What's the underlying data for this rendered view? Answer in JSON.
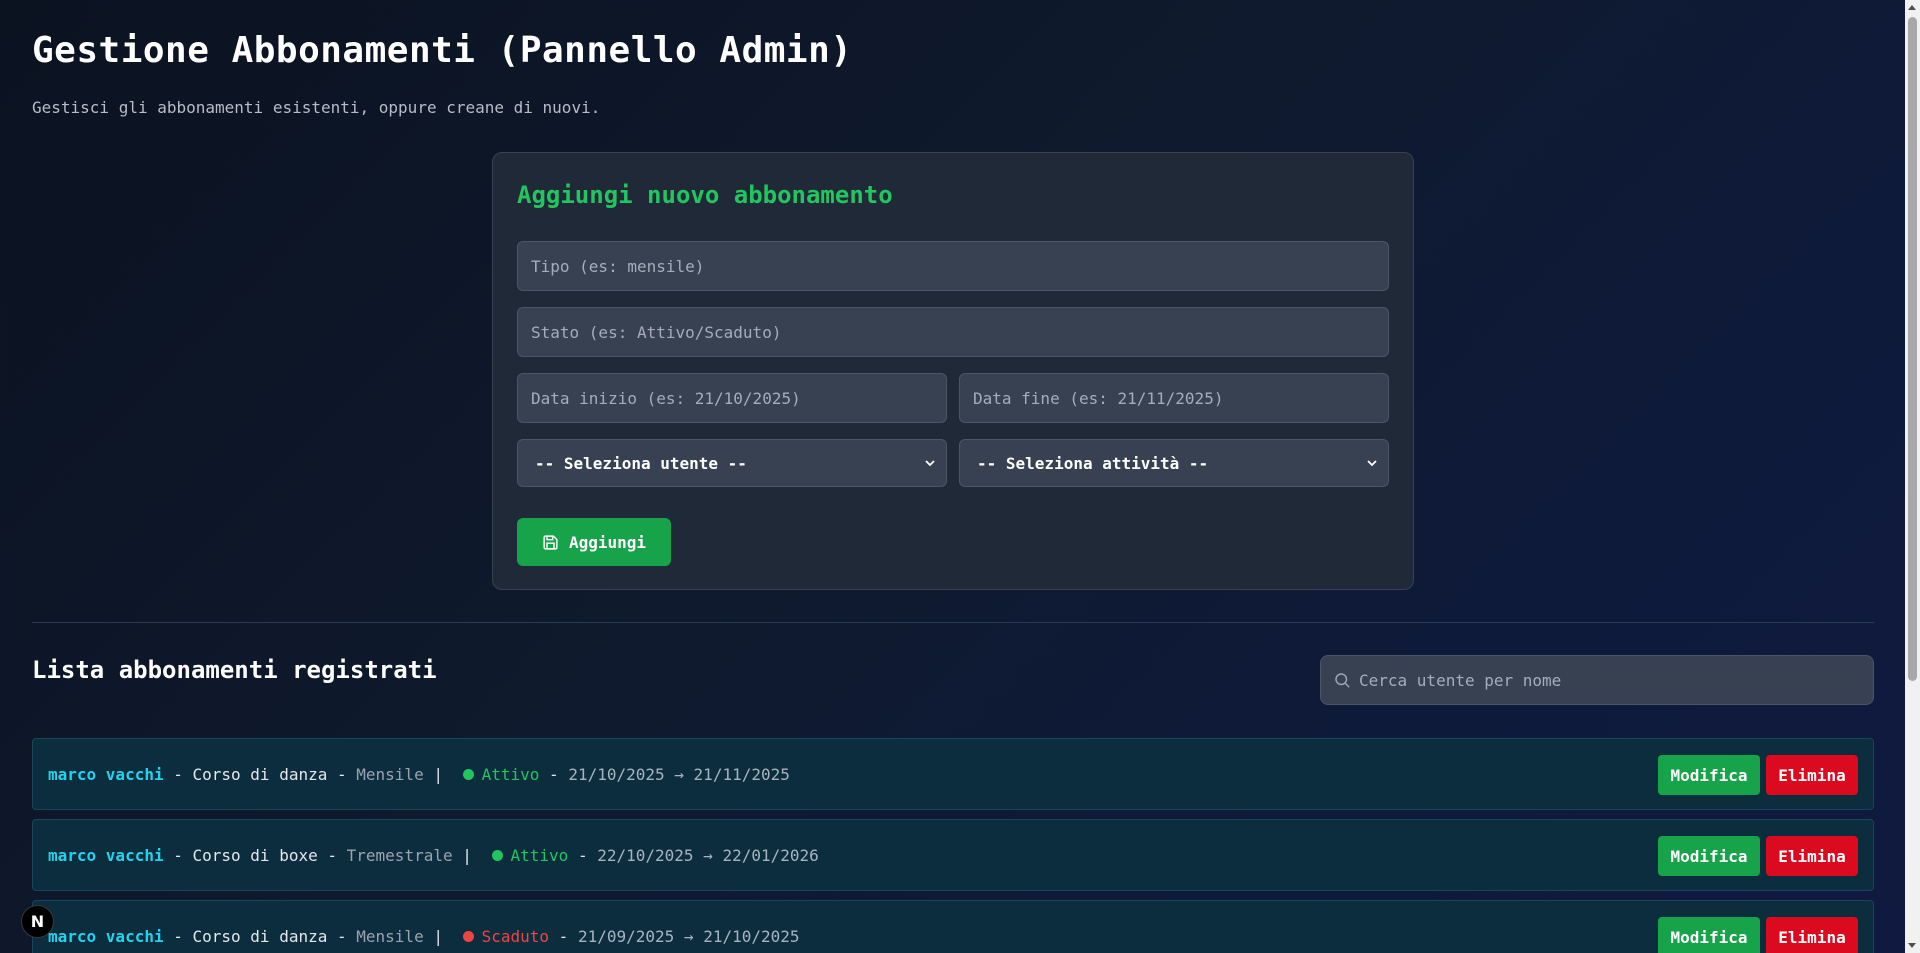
{
  "header": {
    "title": "Gestione Abbonamenti (Pannello Admin)",
    "subtitle": "Gestisci gli abbonamenti esistenti, oppure creane di nuovi."
  },
  "form": {
    "title": "Aggiungi nuovo abbonamento",
    "tipo_placeholder": "Tipo (es: mensile)",
    "stato_placeholder": "Stato (es: Attivo/Scaduto)",
    "data_inizio_placeholder": "Data inizio (es: 21/10/2025)",
    "data_fine_placeholder": "Data fine (es: 21/11/2025)",
    "select_user": "-- Seleziona utente --",
    "select_activity": "-- Seleziona attività --",
    "add_label": "Aggiungi"
  },
  "list": {
    "title": "Lista abbonamenti registrati",
    "search_placeholder": "Cerca utente per nome",
    "separator": " - ",
    "pipe": " | ",
    "arrow": " → ",
    "edit_label": "Modifica",
    "delete_label": "Elimina",
    "items": [
      {
        "user": "marco vacchi",
        "activity": "Corso di danza",
        "type": "Mensile",
        "status": "Attivo",
        "status_color": "#22c55e",
        "start": "21/10/2025",
        "end": "21/11/2025"
      },
      {
        "user": "marco vacchi",
        "activity": "Corso di boxe",
        "type": "Tremestrale",
        "status": "Attivo",
        "status_color": "#22c55e",
        "start": "22/10/2025",
        "end": "22/01/2026"
      },
      {
        "user": "marco vacchi",
        "activity": "Corso di danza",
        "type": "Mensile",
        "status": "Scaduto",
        "status_color": "#ef4444",
        "start": "21/09/2025",
        "end": "21/10/2025"
      }
    ]
  },
  "badge": {
    "label": "N"
  },
  "colors": {
    "accent_green": "#16a34a",
    "delete_red": "#dc0a1e",
    "user_cyan": "#22d3ee"
  }
}
